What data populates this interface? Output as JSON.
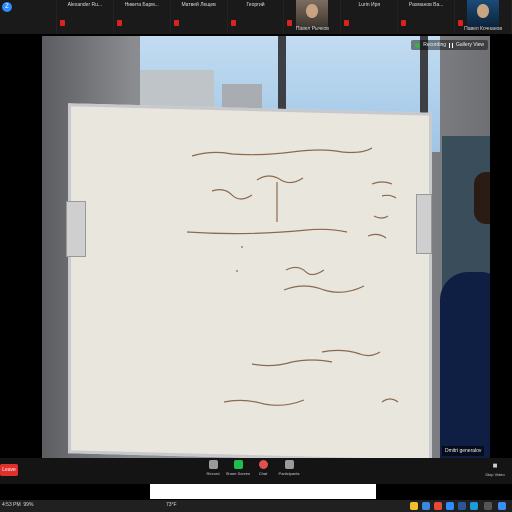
{
  "participants": [
    {
      "name": "",
      "mic_muted": false,
      "badge": "Z"
    },
    {
      "name": "Alexander Ru...",
      "mic_muted": true
    },
    {
      "name": "Никита Барм...",
      "mic_muted": true
    },
    {
      "name": "Матвей Лещев",
      "mic_muted": true
    },
    {
      "name": "Георгий",
      "mic_muted": true
    },
    {
      "name": "Павел Рычков",
      "mic_muted": true,
      "thumb": true
    },
    {
      "name": "Lurin Иря",
      "mic_muted": true
    },
    {
      "name": "Рахманов Ва...",
      "mic_muted": true
    },
    {
      "name": "Павел Кочнанов",
      "mic_muted": true,
      "thumb": true
    }
  ],
  "recording": {
    "label": "Recording",
    "view": "Gallery View"
  },
  "speaker": {
    "name": "Dmitri generalov"
  },
  "controls": {
    "leave": "Leave",
    "items": [
      {
        "label": "Record",
        "icon": "record-icon"
      },
      {
        "label": "Share Screen",
        "icon": "share-screen-icon"
      },
      {
        "label": "Chat",
        "icon": "chat-icon"
      },
      {
        "label": "Participants",
        "icon": "participants-icon",
        "count": "11"
      }
    ],
    "more": "Stop Video"
  },
  "taskbar": {
    "clock": "4:53 PM",
    "battery": "99%",
    "weather": "73°F",
    "icons": [
      "chrome-icon",
      "mail-icon",
      "folder-icon",
      "store-icon",
      "zoom-icon",
      "word-icon",
      "edge-icon",
      "search-icon",
      "windows-icon"
    ]
  },
  "colors": {
    "leave": "#e0302b",
    "share": "#1ebe4c",
    "rec_dot": "#3cb043",
    "strip_bg": "#111111"
  }
}
